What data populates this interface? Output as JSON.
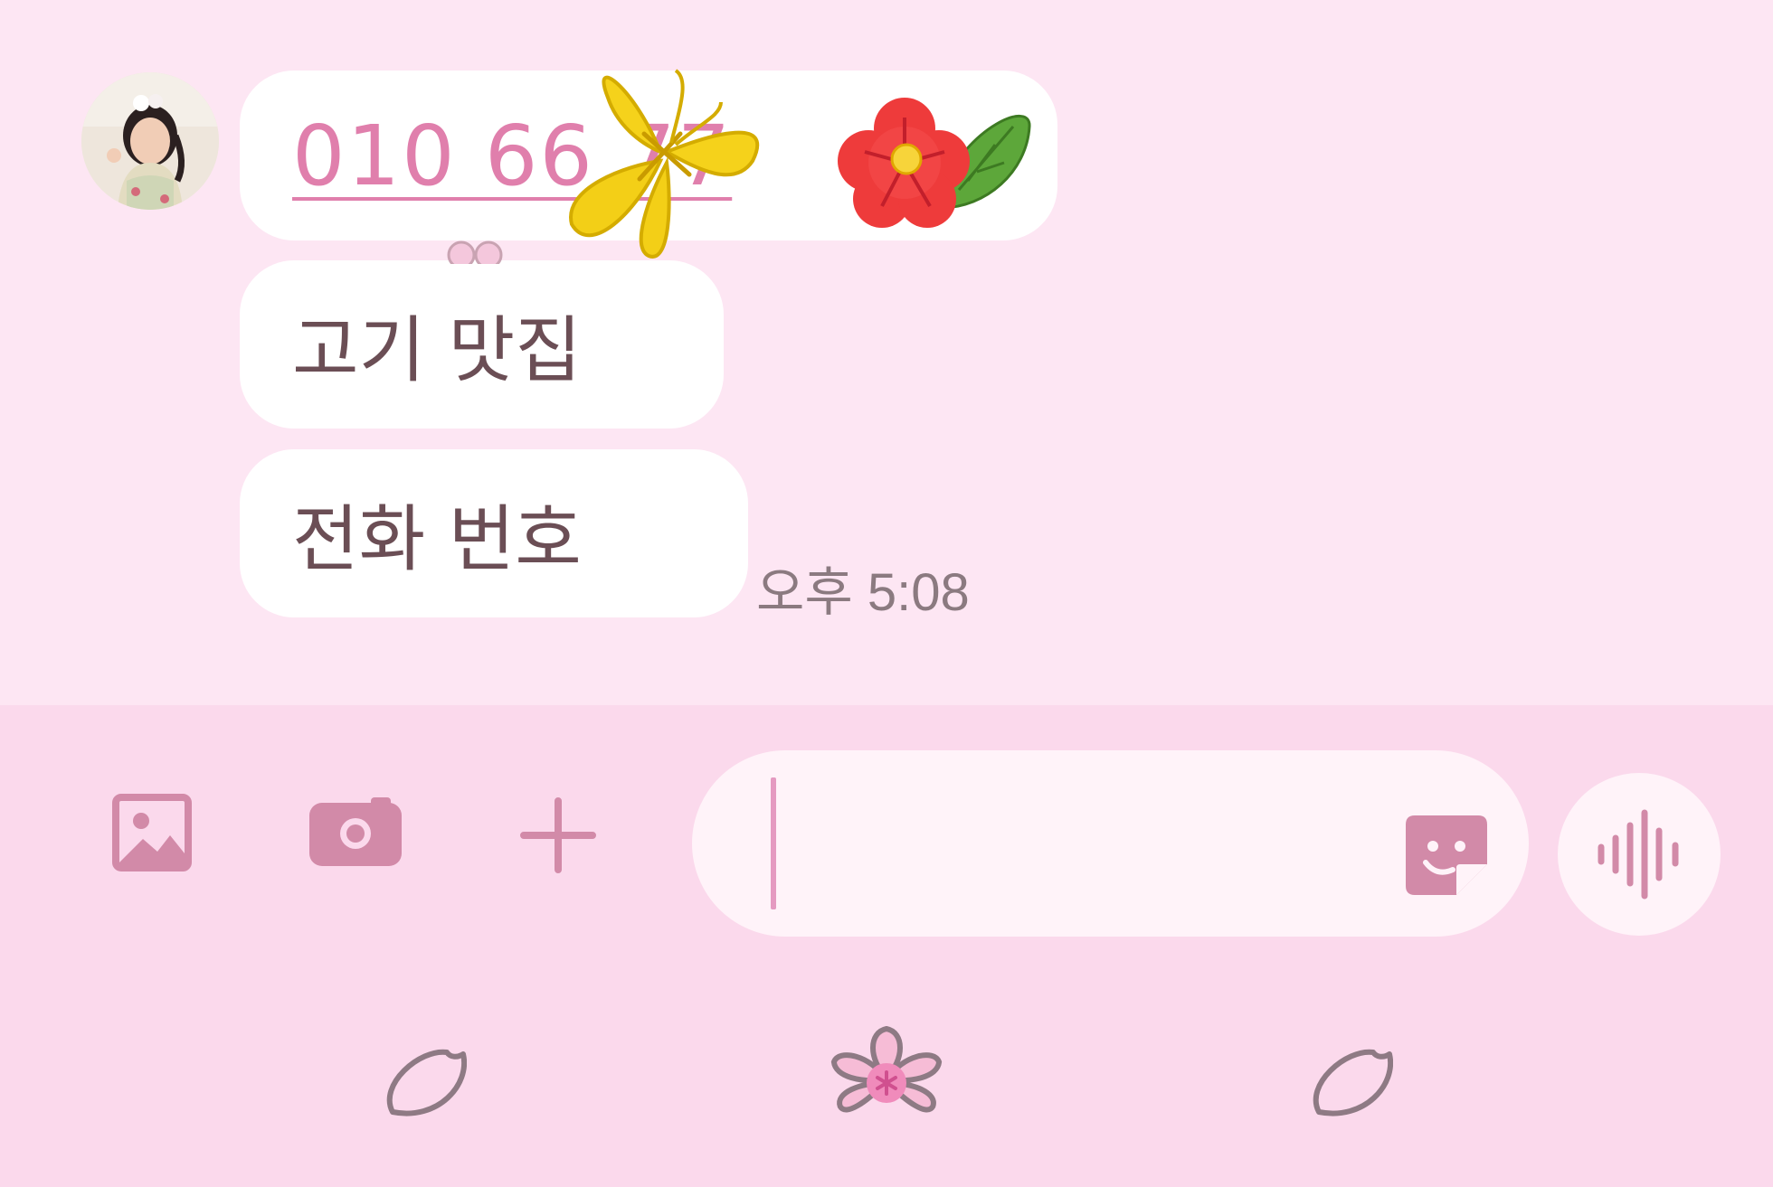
{
  "chat": {
    "messages": [
      {
        "type": "phone-link",
        "text": "010  66       77"
      },
      {
        "type": "text",
        "text": "고기 맛집"
      },
      {
        "type": "text",
        "text": "전화 번호"
      }
    ],
    "timestamp": "오후 5:08"
  },
  "input_bar": {
    "icons": [
      "image-icon",
      "camera-icon",
      "plus-icon",
      "sticker-icon",
      "voice-wave-icon"
    ],
    "message_value": ""
  },
  "nav": {
    "icons": [
      "petal-icon",
      "blossom-icon",
      "petal-icon"
    ]
  },
  "colors": {
    "background": "#fde6f3",
    "input_bar": "#fbd9ec",
    "link": "#e07fac",
    "icon": "#d28aa8",
    "text": "#6b4e55"
  }
}
